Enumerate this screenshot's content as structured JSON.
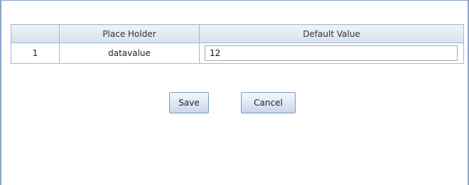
{
  "table": {
    "headers": [
      "",
      "Place Holder",
      "Default Value"
    ],
    "rows": [
      {
        "index": "1",
        "placeholder": "datavalue",
        "default_value": "12"
      }
    ]
  },
  "buttons": {
    "save_label": "Save",
    "cancel_label": "Cancel"
  },
  "colors": {
    "border": "#8ba3c7",
    "header_bg": "#d7e1ef",
    "button_bg": "#dfe8f4"
  }
}
